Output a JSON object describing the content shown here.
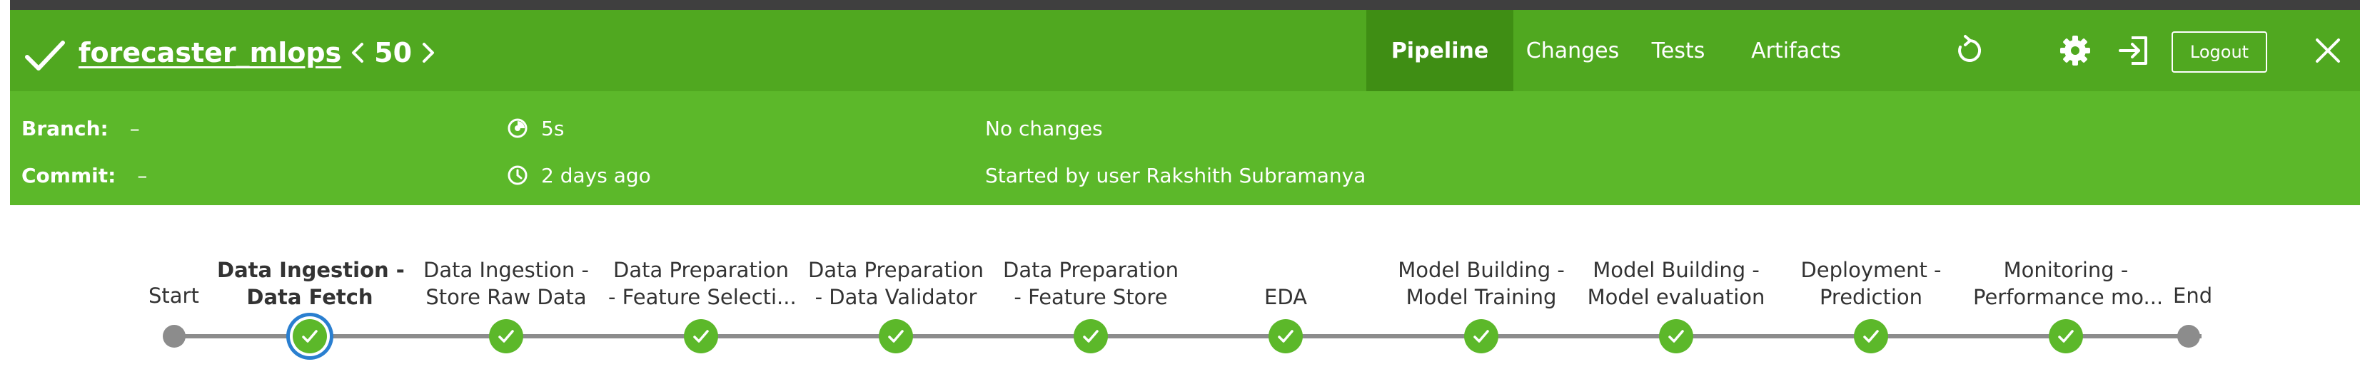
{
  "header": {
    "project_name": "forecaster_mlops",
    "run_number": "50",
    "tabs": [
      {
        "label": "Pipeline",
        "active": true
      },
      {
        "label": "Changes",
        "active": false
      },
      {
        "label": "Tests",
        "active": false
      },
      {
        "label": "Artifacts",
        "active": false
      }
    ],
    "icons": [
      "replay-icon",
      "gear-icon",
      "logout-arrow-icon",
      "close-icon"
    ],
    "logout_label": "Logout"
  },
  "info": {
    "branch_label": "Branch:",
    "branch_value": "–",
    "commit_label": "Commit:",
    "commit_value": "–",
    "duration": "5s",
    "started_ago": "2 days ago",
    "changes": "No changes",
    "started_by": "Started by user Rakshith Subramanya"
  },
  "pipeline": {
    "start_label": "Start",
    "end_label": "End",
    "stages": [
      {
        "line1": "Data Ingestion -",
        "line2": "Data Fetch",
        "status": "success",
        "selected": true
      },
      {
        "line1": "Data Ingestion -",
        "line2": "Store Raw Data",
        "status": "success",
        "selected": false
      },
      {
        "line1": "Data Preparation",
        "line2": "- Feature Selecti...",
        "status": "success",
        "selected": false
      },
      {
        "line1": "Data Preparation",
        "line2": "- Data Validator",
        "status": "success",
        "selected": false
      },
      {
        "line1": "Data Preparation",
        "line2": "- Feature Store",
        "status": "success",
        "selected": false
      },
      {
        "line1": "",
        "line2": "EDA",
        "status": "success",
        "selected": false
      },
      {
        "line1": "Model Building -",
        "line2": "Model Training",
        "status": "success",
        "selected": false
      },
      {
        "line1": "Model Building -",
        "line2": "Model evaluation",
        "status": "success",
        "selected": false
      },
      {
        "line1": "Deployment -",
        "line2": "Prediction",
        "status": "success",
        "selected": false
      },
      {
        "line1": "Monitoring -",
        "line2": "Performance mo...",
        "status": "success",
        "selected": false
      }
    ]
  },
  "colors": {
    "header_bg": "#50a820",
    "active_tab_bg": "#3f8e14",
    "info_bg": "#5cb82a",
    "success": "#5cb82a",
    "selected_ring": "#2a7fd0",
    "track": "#8c8c8c"
  }
}
